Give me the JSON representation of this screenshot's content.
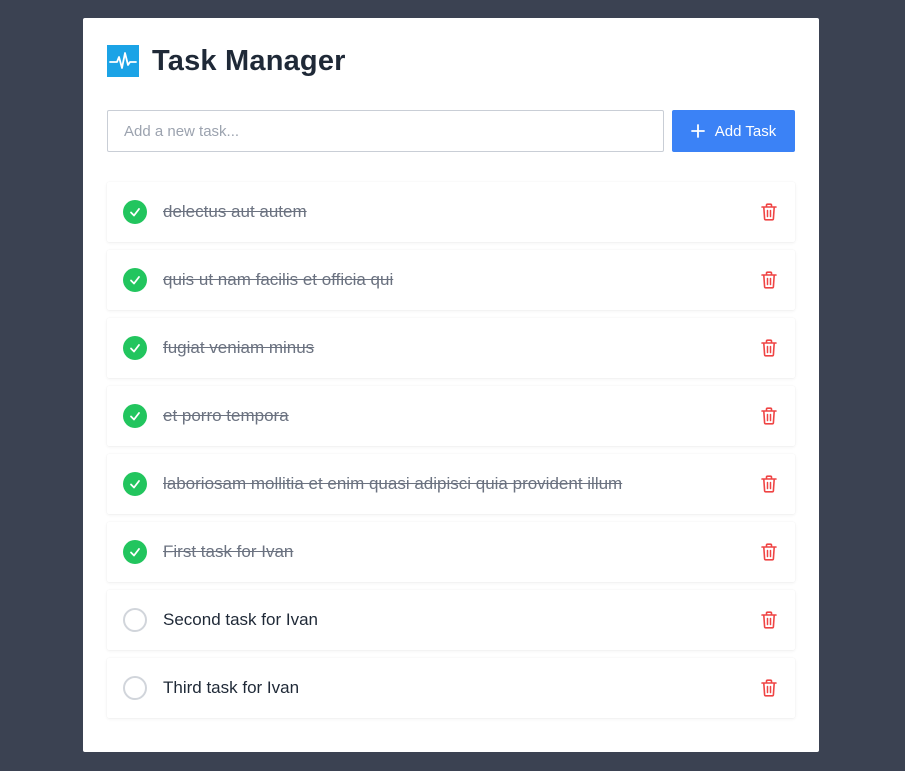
{
  "app": {
    "title": "Task Manager",
    "logo_icon": "activity-pulse-icon",
    "logo_color": "#1ba3e6"
  },
  "add_form": {
    "placeholder": "Add a new task...",
    "value": "",
    "button_label": "Add Task",
    "button_icon": "plus-icon",
    "button_color": "#3b82f6"
  },
  "colors": {
    "background": "#3b4252",
    "check_done": "#22c55e",
    "delete": "#ef4444"
  },
  "tasks": [
    {
      "text": "delectus aut autem",
      "completed": true
    },
    {
      "text": "quis ut nam facilis et officia qui",
      "completed": true
    },
    {
      "text": "fugiat veniam minus",
      "completed": true
    },
    {
      "text": "et porro tempora",
      "completed": true
    },
    {
      "text": "laboriosam mollitia et enim quasi adipisci quia provident illum",
      "completed": true
    },
    {
      "text": "First task for Ivan",
      "completed": true
    },
    {
      "text": "Second task for Ivan",
      "completed": false
    },
    {
      "text": "Third task for Ivan",
      "completed": false
    }
  ]
}
